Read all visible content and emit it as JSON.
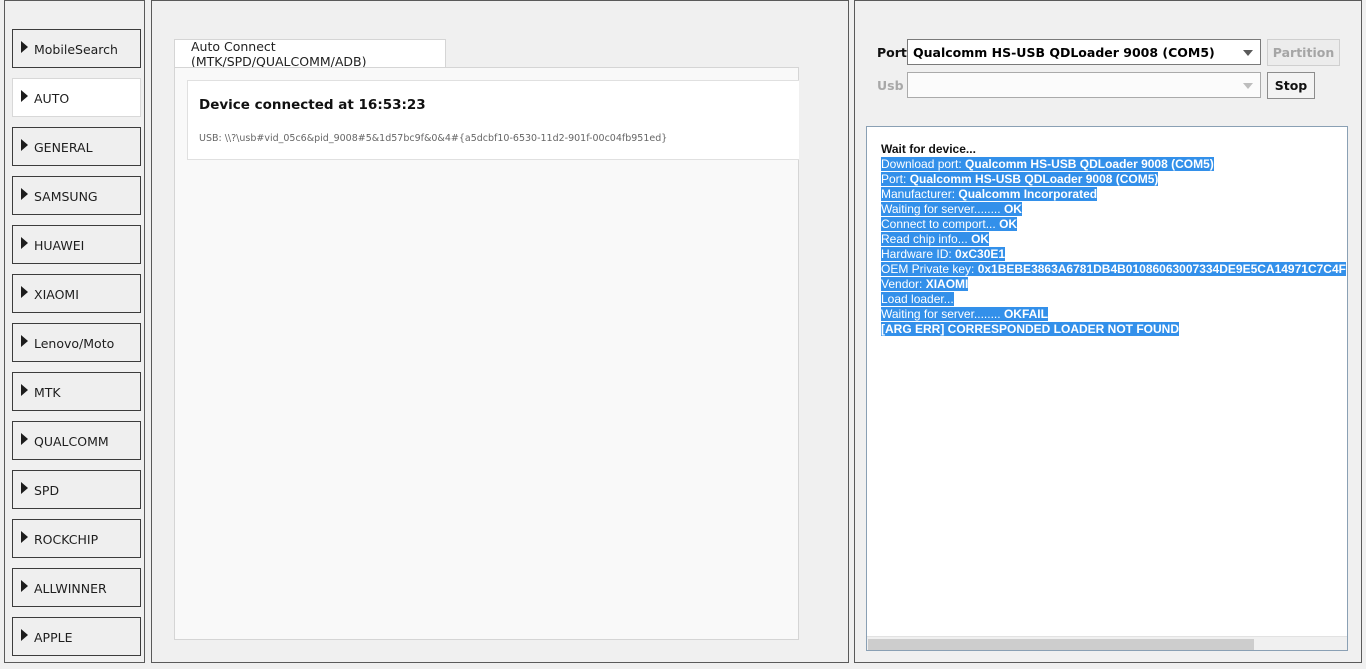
{
  "sidebar": {
    "items": [
      {
        "label": "MobileSearch"
      },
      {
        "label": "AUTO"
      },
      {
        "label": "GENERAL"
      },
      {
        "label": "SAMSUNG"
      },
      {
        "label": "HUAWEI"
      },
      {
        "label": "XIAOMI"
      },
      {
        "label": "Lenovo/Moto"
      },
      {
        "label": "MTK"
      },
      {
        "label": "QUALCOMM"
      },
      {
        "label": "SPD"
      },
      {
        "label": "ROCKCHIP"
      },
      {
        "label": "ALLWINNER"
      },
      {
        "label": "APPLE"
      }
    ],
    "active": "AUTO"
  },
  "main": {
    "tab_label": "Auto Connect (MTK/SPD/QUALCOMM/ADB)",
    "device_title": "Device connected at 16:53:23",
    "device_usb": "USB: \\\\?\\usb#vid_05c6&pid_9008#5&1d57bc9f&0&4#{a5dcbf10-6530-11d2-901f-00c04fb951ed}"
  },
  "connection": {
    "port_label": "Port",
    "port_value": "Qualcomm HS-USB QDLoader 9008 (COM5)",
    "usb_label": "Usb",
    "usb_value": "",
    "partition_label": "Partition",
    "stop_label": "Stop"
  },
  "log": {
    "first": "Wait for device...",
    "lines": [
      {
        "prefix": "Download port: ",
        "value": "Qualcomm HS-USB QDLoader 9008 (COM5)"
      },
      {
        "prefix": "Port: ",
        "value": "Qualcomm HS-USB QDLoader 9008 (COM5)"
      },
      {
        "prefix": "Manufacturer: ",
        "value": "Qualcomm Incorporated"
      },
      {
        "prefix": "Waiting for server........ ",
        "value": "OK"
      },
      {
        "prefix": "Connect to comport... ",
        "value": "OK"
      },
      {
        "prefix": "Read chip info... ",
        "value": "OK"
      },
      {
        "prefix": "Hardware ID: ",
        "value": "0xC30E1"
      },
      {
        "prefix": "OEM Private key: ",
        "value": "0x1BEBE3863A6781DB4B01086063007334DE9E5CA14971C7C4F"
      },
      {
        "prefix": "Vendor: ",
        "value": "XIAOMI"
      },
      {
        "prefix": "Load loader...  ",
        "value": ""
      },
      {
        "prefix": "Waiting for server........ ",
        "value": "OKFAIL"
      },
      {
        "prefix": "",
        "value": "  [ARG ERR] CORRESPONDED LOADER NOT FOUND"
      }
    ]
  },
  "colors": {
    "selection": "#3390ea",
    "panel_bg": "#f0f0f0"
  }
}
